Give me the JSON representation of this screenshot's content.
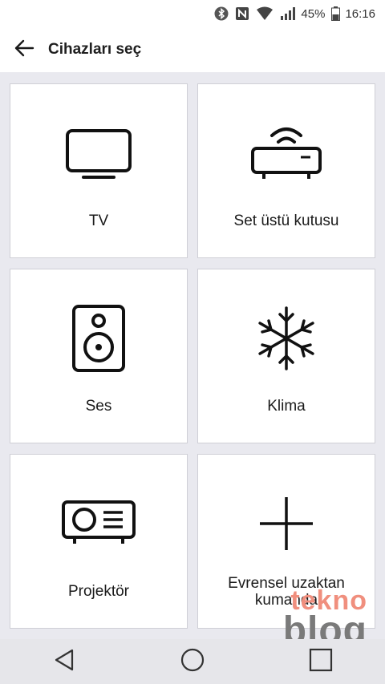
{
  "status_bar": {
    "battery": "45%",
    "time": "16:16",
    "icons": [
      "bluetooth-icon",
      "nfc-icon",
      "wifi-icon",
      "signal-icon",
      "battery-icon"
    ]
  },
  "header": {
    "title": "Cihazları seç",
    "back_icon": "arrow-left-icon"
  },
  "devices": [
    {
      "label": "TV",
      "icon": "tv-icon"
    },
    {
      "label": "Set üstü kutusu",
      "icon": "set-top-box-icon"
    },
    {
      "label": "Ses",
      "icon": "speaker-icon"
    },
    {
      "label": "Klima",
      "icon": "snowflake-icon"
    },
    {
      "label": "Projektör",
      "icon": "projector-icon"
    },
    {
      "label": "Evrensel uzaktan kumanda",
      "icon": "plus-icon"
    }
  ],
  "nav_bar": {
    "buttons": [
      "back-triangle-icon",
      "home-circle-icon",
      "recents-square-icon"
    ]
  },
  "watermark": {
    "line1": "tekno",
    "line2": "blog"
  },
  "colors": {
    "background": "#e9e9ef",
    "tile": "#ffffff",
    "tile_border": "#cfcfd6",
    "navbar": "#e6e6ea",
    "watermark_red": "#f08f7e",
    "watermark_gray": "#7a7a7a"
  }
}
